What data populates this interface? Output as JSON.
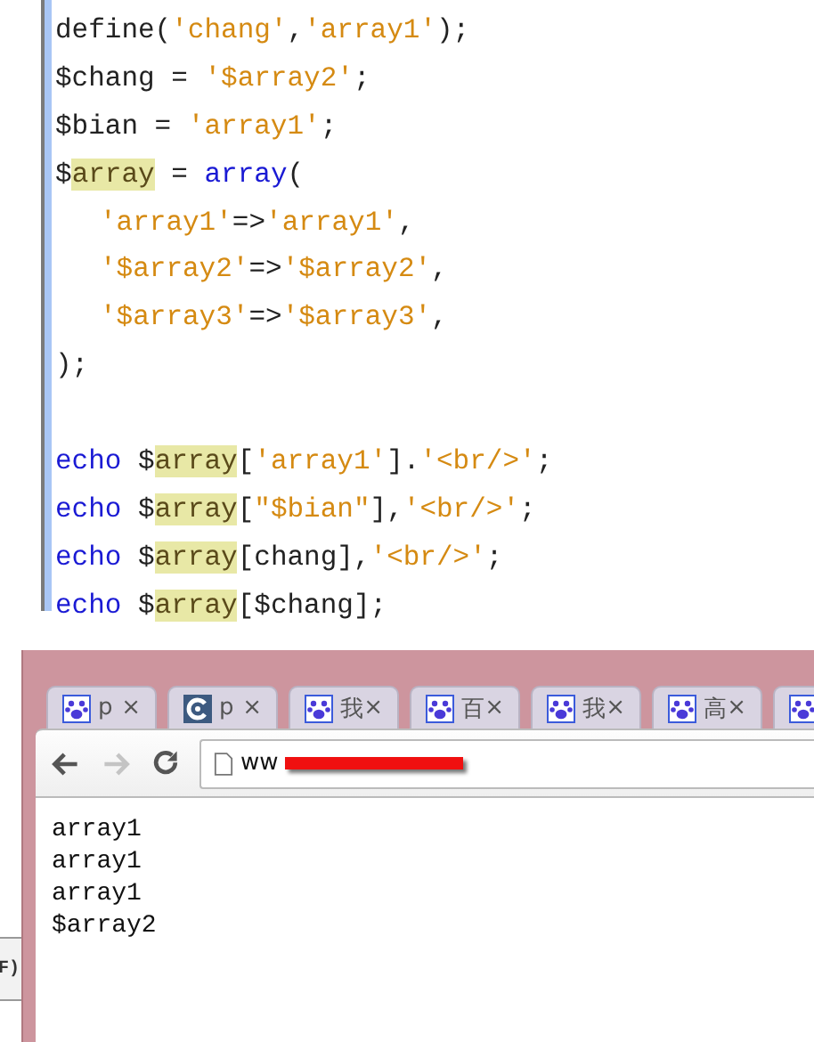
{
  "editor": {
    "blocks": [
      {
        "lines": [
          {
            "tokens": [
              {
                "text": "define(",
                "kind": "plain"
              },
              {
                "text": "'chang'",
                "kind": "string"
              },
              {
                "text": ",",
                "kind": "plain"
              },
              {
                "text": "'array1'",
                "kind": "string"
              },
              {
                "text": ");",
                "kind": "plain"
              }
            ]
          },
          {
            "tokens": [
              {
                "text": "$chang = ",
                "kind": "plain"
              },
              {
                "text": "'$array2'",
                "kind": "string"
              },
              {
                "text": ";",
                "kind": "plain"
              }
            ]
          },
          {
            "tokens": [
              {
                "text": "$bian = ",
                "kind": "plain"
              },
              {
                "text": "'array1'",
                "kind": "string"
              },
              {
                "text": ";",
                "kind": "plain"
              }
            ]
          },
          {
            "tokens": [
              {
                "text": "$",
                "kind": "plain"
              },
              {
                "text": "array",
                "kind": "highlight"
              },
              {
                "text": " = ",
                "kind": "plain"
              },
              {
                "text": "array",
                "kind": "keyword"
              },
              {
                "text": "(",
                "kind": "plain"
              }
            ],
            "children": [
              {
                "tokens": [
                  {
                    "text": "'array1'",
                    "kind": "string"
                  },
                  {
                    "text": "=>",
                    "kind": "plain"
                  },
                  {
                    "text": "'array1'",
                    "kind": "string"
                  },
                  {
                    "text": ",",
                    "kind": "plain"
                  }
                ]
              },
              {
                "tokens": [
                  {
                    "text": "'$array2'",
                    "kind": "string"
                  },
                  {
                    "text": "=>",
                    "kind": "plain"
                  },
                  {
                    "text": "'$array2'",
                    "kind": "string"
                  },
                  {
                    "text": ",",
                    "kind": "plain"
                  }
                ]
              },
              {
                "tokens": [
                  {
                    "text": "'$array3'",
                    "kind": "string"
                  },
                  {
                    "text": "=>",
                    "kind": "plain"
                  },
                  {
                    "text": "'$array3'",
                    "kind": "string"
                  },
                  {
                    "text": ",",
                    "kind": "plain"
                  }
                ]
              }
            ]
          },
          {
            "tokens": [
              {
                "text": ");",
                "kind": "plain"
              }
            ]
          }
        ]
      },
      {
        "lines": [
          {
            "tokens": [
              {
                "text": "echo",
                "kind": "keyword"
              },
              {
                "text": " $",
                "kind": "plain"
              },
              {
                "text": "array",
                "kind": "highlight"
              },
              {
                "text": "[",
                "kind": "plain"
              },
              {
                "text": "'array1'",
                "kind": "string"
              },
              {
                "text": "].",
                "kind": "plain"
              },
              {
                "text": "'<br/>'",
                "kind": "string"
              },
              {
                "text": ";",
                "kind": "plain"
              }
            ]
          },
          {
            "tokens": [
              {
                "text": "echo",
                "kind": "keyword"
              },
              {
                "text": " $",
                "kind": "plain"
              },
              {
                "text": "array",
                "kind": "highlight"
              },
              {
                "text": "[",
                "kind": "plain"
              },
              {
                "text": "\"$bian\"",
                "kind": "string"
              },
              {
                "text": "],",
                "kind": "plain"
              },
              {
                "text": "'<br/>'",
                "kind": "string"
              },
              {
                "text": ";",
                "kind": "plain"
              }
            ]
          },
          {
            "tokens": [
              {
                "text": "echo",
                "kind": "keyword"
              },
              {
                "text": " $",
                "kind": "plain"
              },
              {
                "text": "array",
                "kind": "highlight"
              },
              {
                "text": "[chang],",
                "kind": "plain"
              },
              {
                "text": "'<br/>'",
                "kind": "string"
              },
              {
                "text": ";",
                "kind": "plain"
              }
            ]
          },
          {
            "tokens": [
              {
                "text": "echo",
                "kind": "keyword"
              },
              {
                "text": " $",
                "kind": "plain"
              },
              {
                "text": "array",
                "kind": "highlight"
              },
              {
                "text": "[$chang];",
                "kind": "plain"
              }
            ]
          }
        ]
      }
    ]
  },
  "side_panel": {
    "text": "F)"
  },
  "browser": {
    "tabs": [
      {
        "title": "p",
        "kind": "paw",
        "selected": false
      },
      {
        "title": "p",
        "kind": "swirl",
        "selected": false
      },
      {
        "title": "我",
        "kind": "paw",
        "selected": false
      },
      {
        "title": "百",
        "kind": "paw",
        "selected": false
      },
      {
        "title": "我",
        "kind": "paw",
        "selected": false
      },
      {
        "title": "高",
        "kind": "paw",
        "selected": false
      },
      {
        "kind": "paw",
        "selected": false
      }
    ],
    "close_glyph": "×",
    "toolbar": {
      "back_disabled": false,
      "forward_disabled": true
    },
    "url": "ww",
    "output_lines": [
      "array1",
      "array1",
      "array1",
      "$array2"
    ]
  }
}
